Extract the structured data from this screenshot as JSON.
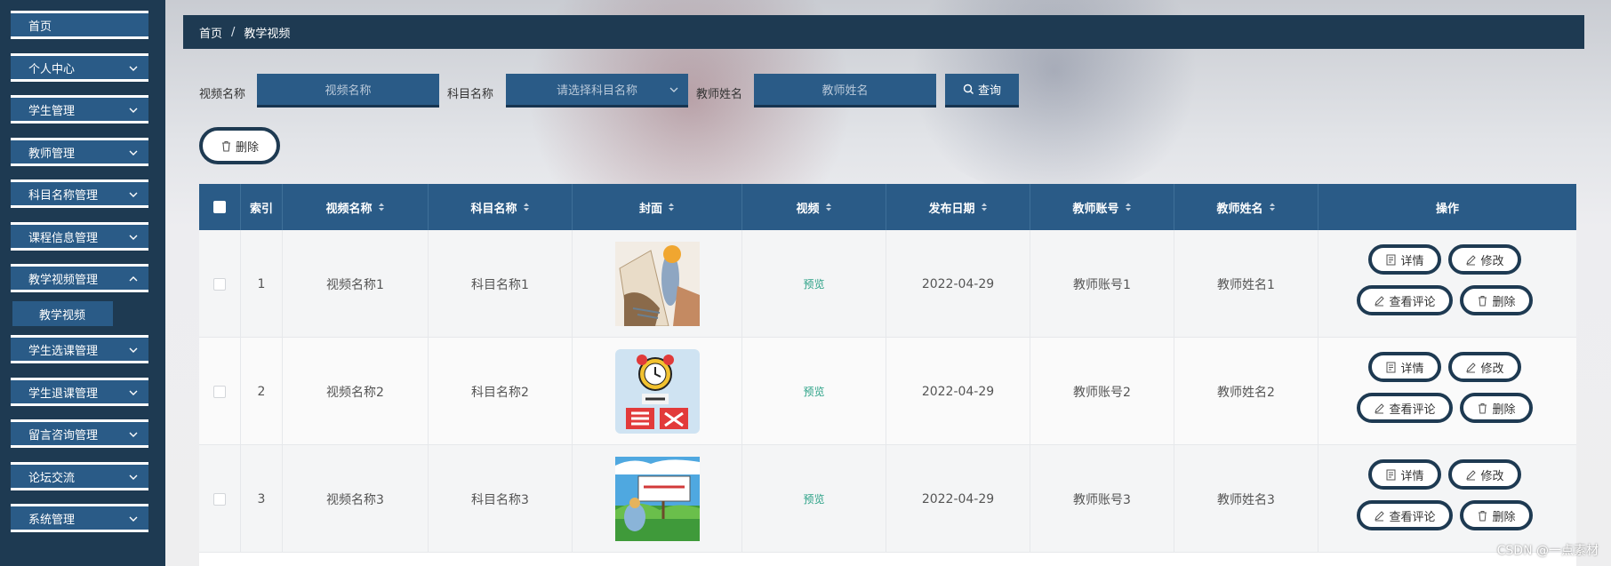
{
  "sidebar": {
    "items": [
      {
        "label": "首页",
        "has_arrow": false
      },
      {
        "label": "个人中心",
        "has_arrow": true
      },
      {
        "label": "学生管理",
        "has_arrow": true
      },
      {
        "label": "教师管理",
        "has_arrow": true
      },
      {
        "label": "科目名称管理",
        "has_arrow": true
      },
      {
        "label": "课程信息管理",
        "has_arrow": true
      },
      {
        "label": "教学视频管理",
        "has_arrow": true
      },
      {
        "label": "学生选课管理",
        "has_arrow": true
      },
      {
        "label": "学生退课管理",
        "has_arrow": true
      },
      {
        "label": "留言咨询管理",
        "has_arrow": true
      },
      {
        "label": "论坛交流",
        "has_arrow": true
      },
      {
        "label": "系统管理",
        "has_arrow": true
      }
    ],
    "sub_item": "教学视频"
  },
  "breadcrumb": {
    "home": "首页",
    "separator": "/",
    "current": "教学视频"
  },
  "search": {
    "video_name_label": "视频名称",
    "video_name_placeholder": "视频名称",
    "subject_label": "科目名称",
    "subject_placeholder": "请选择科目名称",
    "teacher_label": "教师姓名",
    "teacher_placeholder": "教师姓名",
    "query_label": "查询"
  },
  "toolbar": {
    "delete_label": "删除"
  },
  "table": {
    "headers": {
      "index": "索引",
      "video_name": "视频名称",
      "subject": "科目名称",
      "cover": "封面",
      "video": "视频",
      "publish_date": "发布日期",
      "teacher_account": "教师账号",
      "teacher_name": "教师姓名",
      "actions": "操作"
    },
    "rows": [
      {
        "index": "1",
        "video_name": "视频名称1",
        "subject": "科目名称1",
        "cover": "painting-thumbnail",
        "video": "预览",
        "publish_date": "2022-04-29",
        "teacher_account": "教师账号1",
        "teacher_name": "教师姓名1"
      },
      {
        "index": "2",
        "video_name": "视频名称2",
        "subject": "科目名称2",
        "cover": "chinese-exam-thumbnail",
        "video": "预览",
        "publish_date": "2022-04-29",
        "teacher_account": "教师账号2",
        "teacher_name": "教师姓名2"
      },
      {
        "index": "3",
        "video_name": "视频名称3",
        "subject": "科目名称3",
        "cover": "landscape-sign-thumbnail",
        "video": "预览",
        "publish_date": "2022-04-29",
        "teacher_account": "教师账号3",
        "teacher_name": "教师姓名3"
      }
    ],
    "actions": {
      "detail": "详情",
      "edit": "修改",
      "comments": "查看评论",
      "delete": "删除"
    }
  },
  "watermark": "CSDN @一点素材",
  "colors": {
    "sidebar_bg": "#1e3a52",
    "accent": "#2a5b87",
    "preview_link": "#2aa186"
  }
}
